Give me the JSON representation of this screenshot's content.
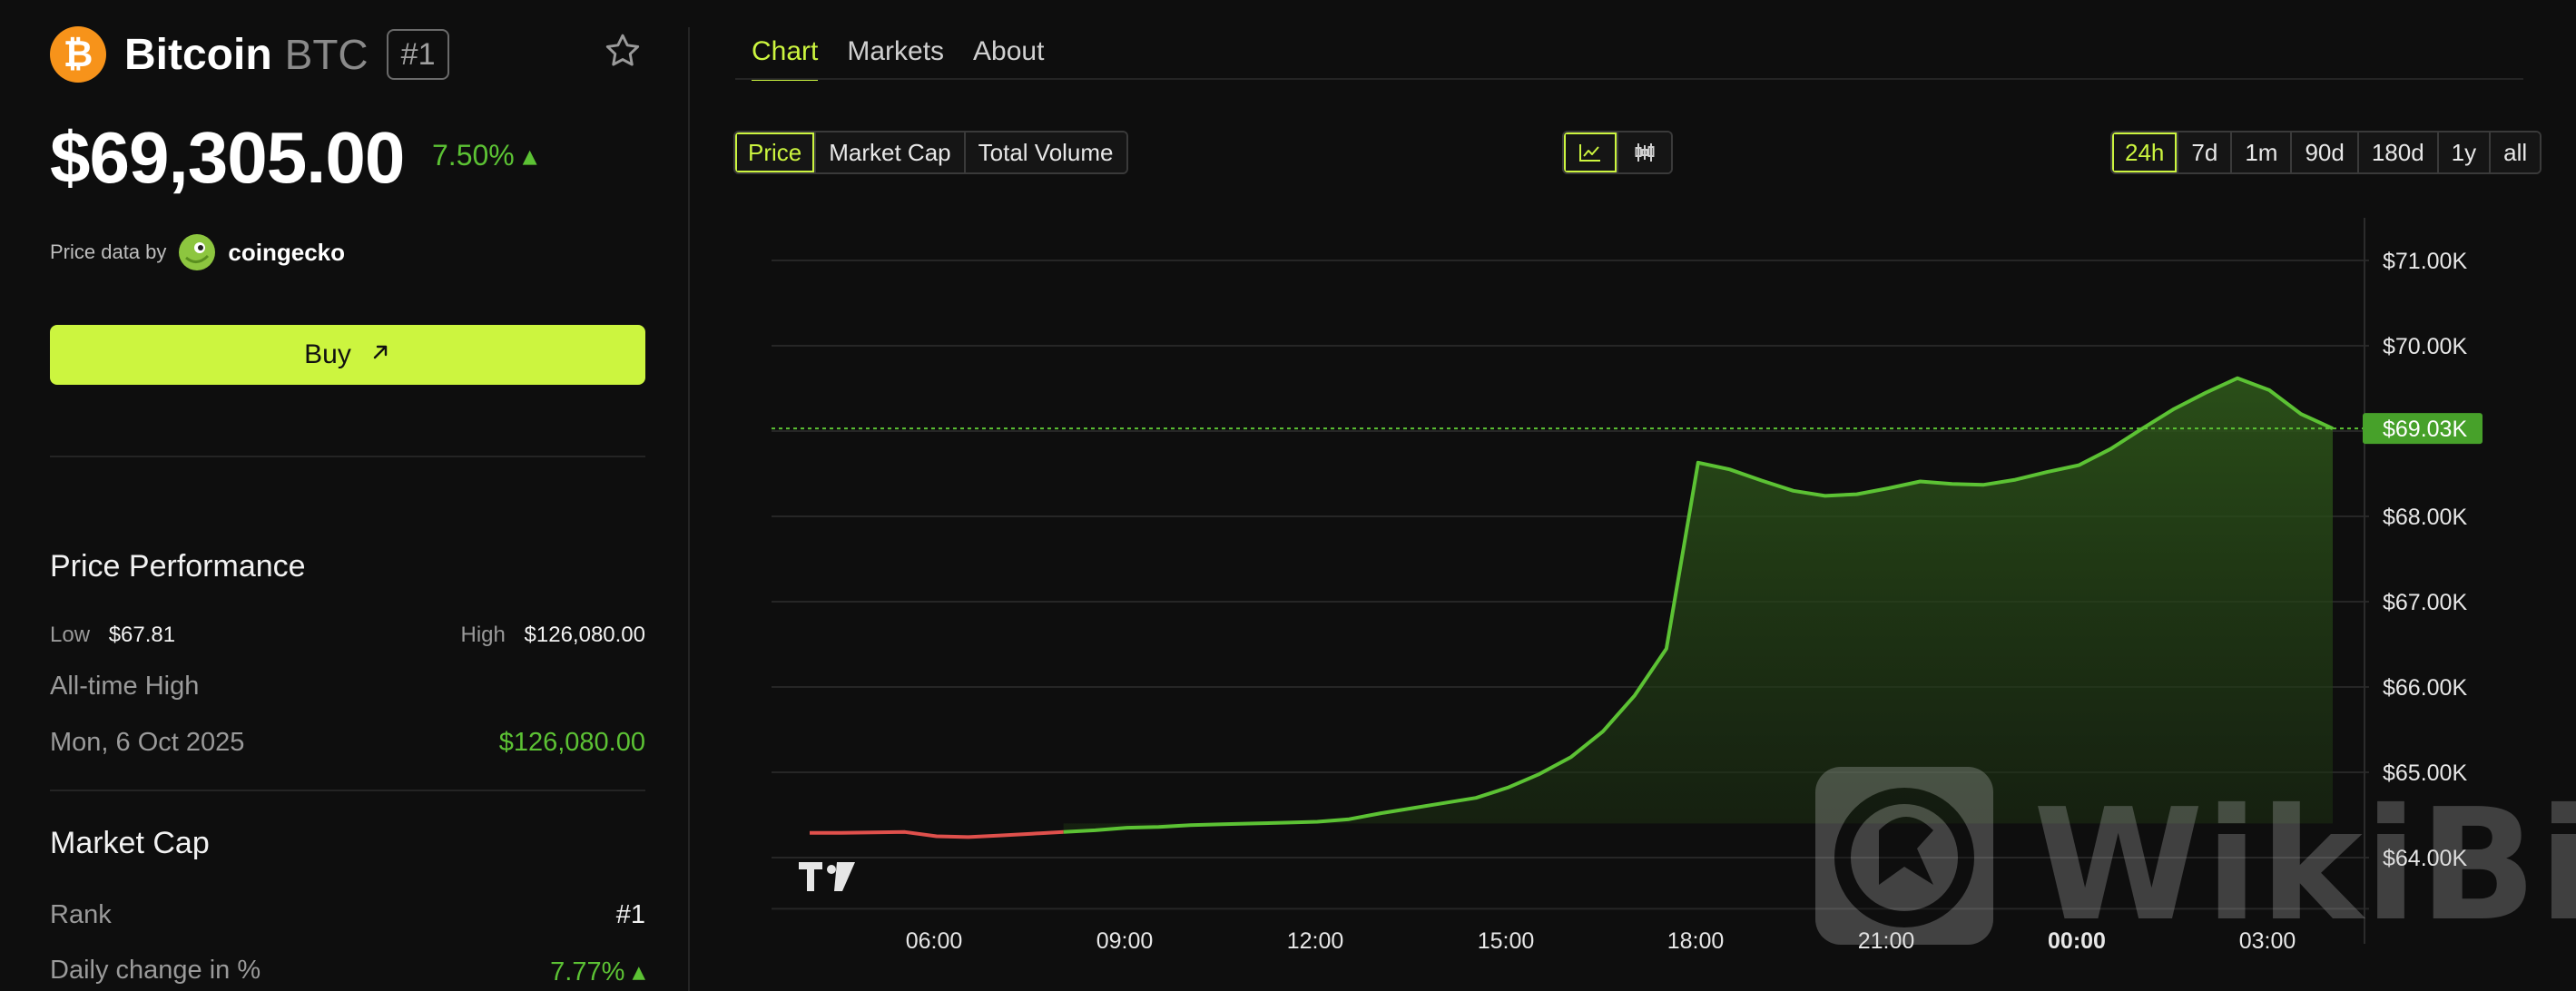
{
  "coin": {
    "logo_glyph": "₿",
    "name": "Bitcoin",
    "symbol": "BTC",
    "rank_badge": "#1",
    "favorite_icon": "star-outline-icon",
    "price": "$69,305.00",
    "change_24h": "7.50% ▴",
    "change_color": "#5cc234"
  },
  "price_source": {
    "label": "Price data by",
    "provider": "coingecko"
  },
  "buy_button": {
    "label": "Buy",
    "icon": "arrow-up-right-icon",
    "color": "#ccf53f"
  },
  "performance": {
    "title": "Price Performance",
    "low_label": "Low",
    "low_value": "$67.81",
    "high_label": "High",
    "high_value": "$126,080.00",
    "ath_label": "All-time High",
    "ath_date": "Mon, 6 Oct 2025",
    "ath_value": "$126,080.00"
  },
  "market_cap": {
    "title": "Market Cap",
    "rank_label": "Rank",
    "rank_value": "#1",
    "daily_change_label": "Daily change in %",
    "daily_change_value": "7.77% ▴"
  },
  "tabs": [
    {
      "label": "Chart",
      "active": true
    },
    {
      "label": "Markets",
      "active": false
    },
    {
      "label": "About",
      "active": false
    }
  ],
  "metric_toggle": [
    {
      "label": "Price",
      "active": true
    },
    {
      "label": "Market Cap",
      "active": false
    },
    {
      "label": "Total Volume",
      "active": false
    }
  ],
  "chart_type_toggle": [
    {
      "icon": "line-chart-icon",
      "active": true
    },
    {
      "icon": "candlestick-icon",
      "active": false
    }
  ],
  "timeframes": [
    {
      "label": "24h",
      "active": true
    },
    {
      "label": "7d",
      "active": false
    },
    {
      "label": "1m",
      "active": false
    },
    {
      "label": "90d",
      "active": false
    },
    {
      "label": "180d",
      "active": false
    },
    {
      "label": "1y",
      "active": false
    },
    {
      "label": "all",
      "active": false
    }
  ],
  "watermark": {
    "text": "WikiBit"
  },
  "colors": {
    "accent": "#ccf53f",
    "up": "#5cc234",
    "down": "#e0504c",
    "background": "#0e0e0e"
  },
  "chart_data": {
    "type": "line",
    "series": [
      {
        "x": [
          "04:00",
          "04:30",
          "05:00",
          "05:30",
          "06:00",
          "06:30",
          "07:00",
          "07:30",
          "08:00",
          "08:30",
          "09:00",
          "09:30",
          "10:00",
          "10:30",
          "11:00",
          "11:30",
          "12:00",
          "12:30",
          "13:00",
          "13:30",
          "14:00",
          "14:30",
          "15:00",
          "15:30",
          "16:00",
          "16:30",
          "17:00",
          "17:30",
          "18:00",
          "18:30",
          "19:00",
          "19:30",
          "20:00",
          "20:30",
          "21:00",
          "21:30",
          "22:00",
          "22:30",
          "23:00",
          "23:30",
          "00:00",
          "00:30",
          "01:00",
          "01:30",
          "02:00",
          "02:30",
          "03:00",
          "03:30",
          "04:00"
        ],
        "y": [
          64290,
          64290,
          64295,
          64300,
          64250,
          64240,
          64260,
          64280,
          64300,
          64320,
          64350,
          64360,
          64380,
          64390,
          64400,
          64410,
          64420,
          64450,
          64520,
          64580,
          64640,
          64700,
          64820,
          64980,
          65180,
          65480,
          65900,
          66450,
          68630,
          68550,
          68420,
          68300,
          68240,
          68260,
          68330,
          68410,
          68380,
          68370,
          68430,
          68520,
          68600,
          68790,
          69030,
          69260,
          69450,
          69620,
          69480,
          69200,
          69030
        ]
      }
    ],
    "yticks": [
      "$71.00K",
      "$70.00K",
      "$69.03K",
      "$68.00K",
      "$67.00K",
      "$66.00K",
      "$65.00K",
      "$64.00K"
    ],
    "current_value_label": "$69.03K",
    "current_value": 69030,
    "xticks": [
      "06:00",
      "09:00",
      "12:00",
      "15:00",
      "18:00",
      "21:00",
      "00:00",
      "03:00"
    ],
    "ylim": [
      63300,
      71000
    ],
    "grid": true,
    "legend": "none"
  }
}
